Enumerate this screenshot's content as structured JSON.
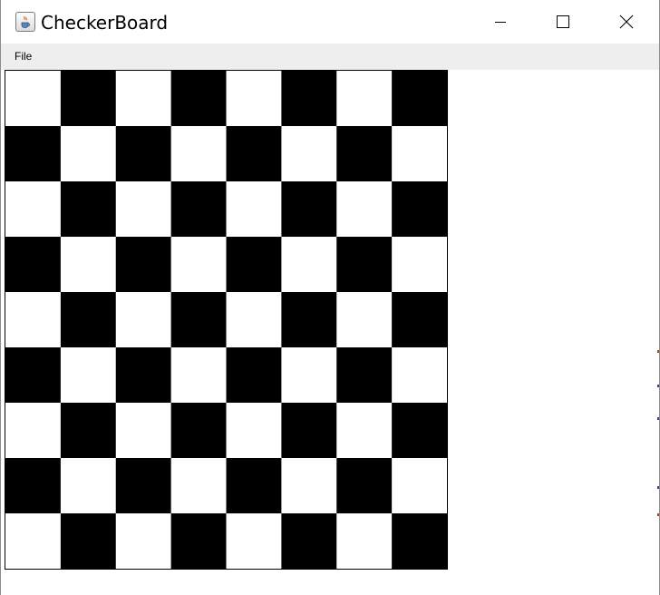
{
  "window": {
    "title": "CheckerBoard",
    "icon": "java-cup-icon"
  },
  "controls": {
    "minimize": "minimize-icon",
    "maximize": "maximize-icon",
    "close": "close-icon"
  },
  "menu": {
    "items": [
      {
        "label": "File"
      }
    ]
  },
  "board": {
    "rows": 9,
    "cols": 8,
    "top_left_color": "white",
    "colors": {
      "dark": "#000000",
      "light": "#ffffff",
      "menubar": "#eeeeee"
    }
  }
}
